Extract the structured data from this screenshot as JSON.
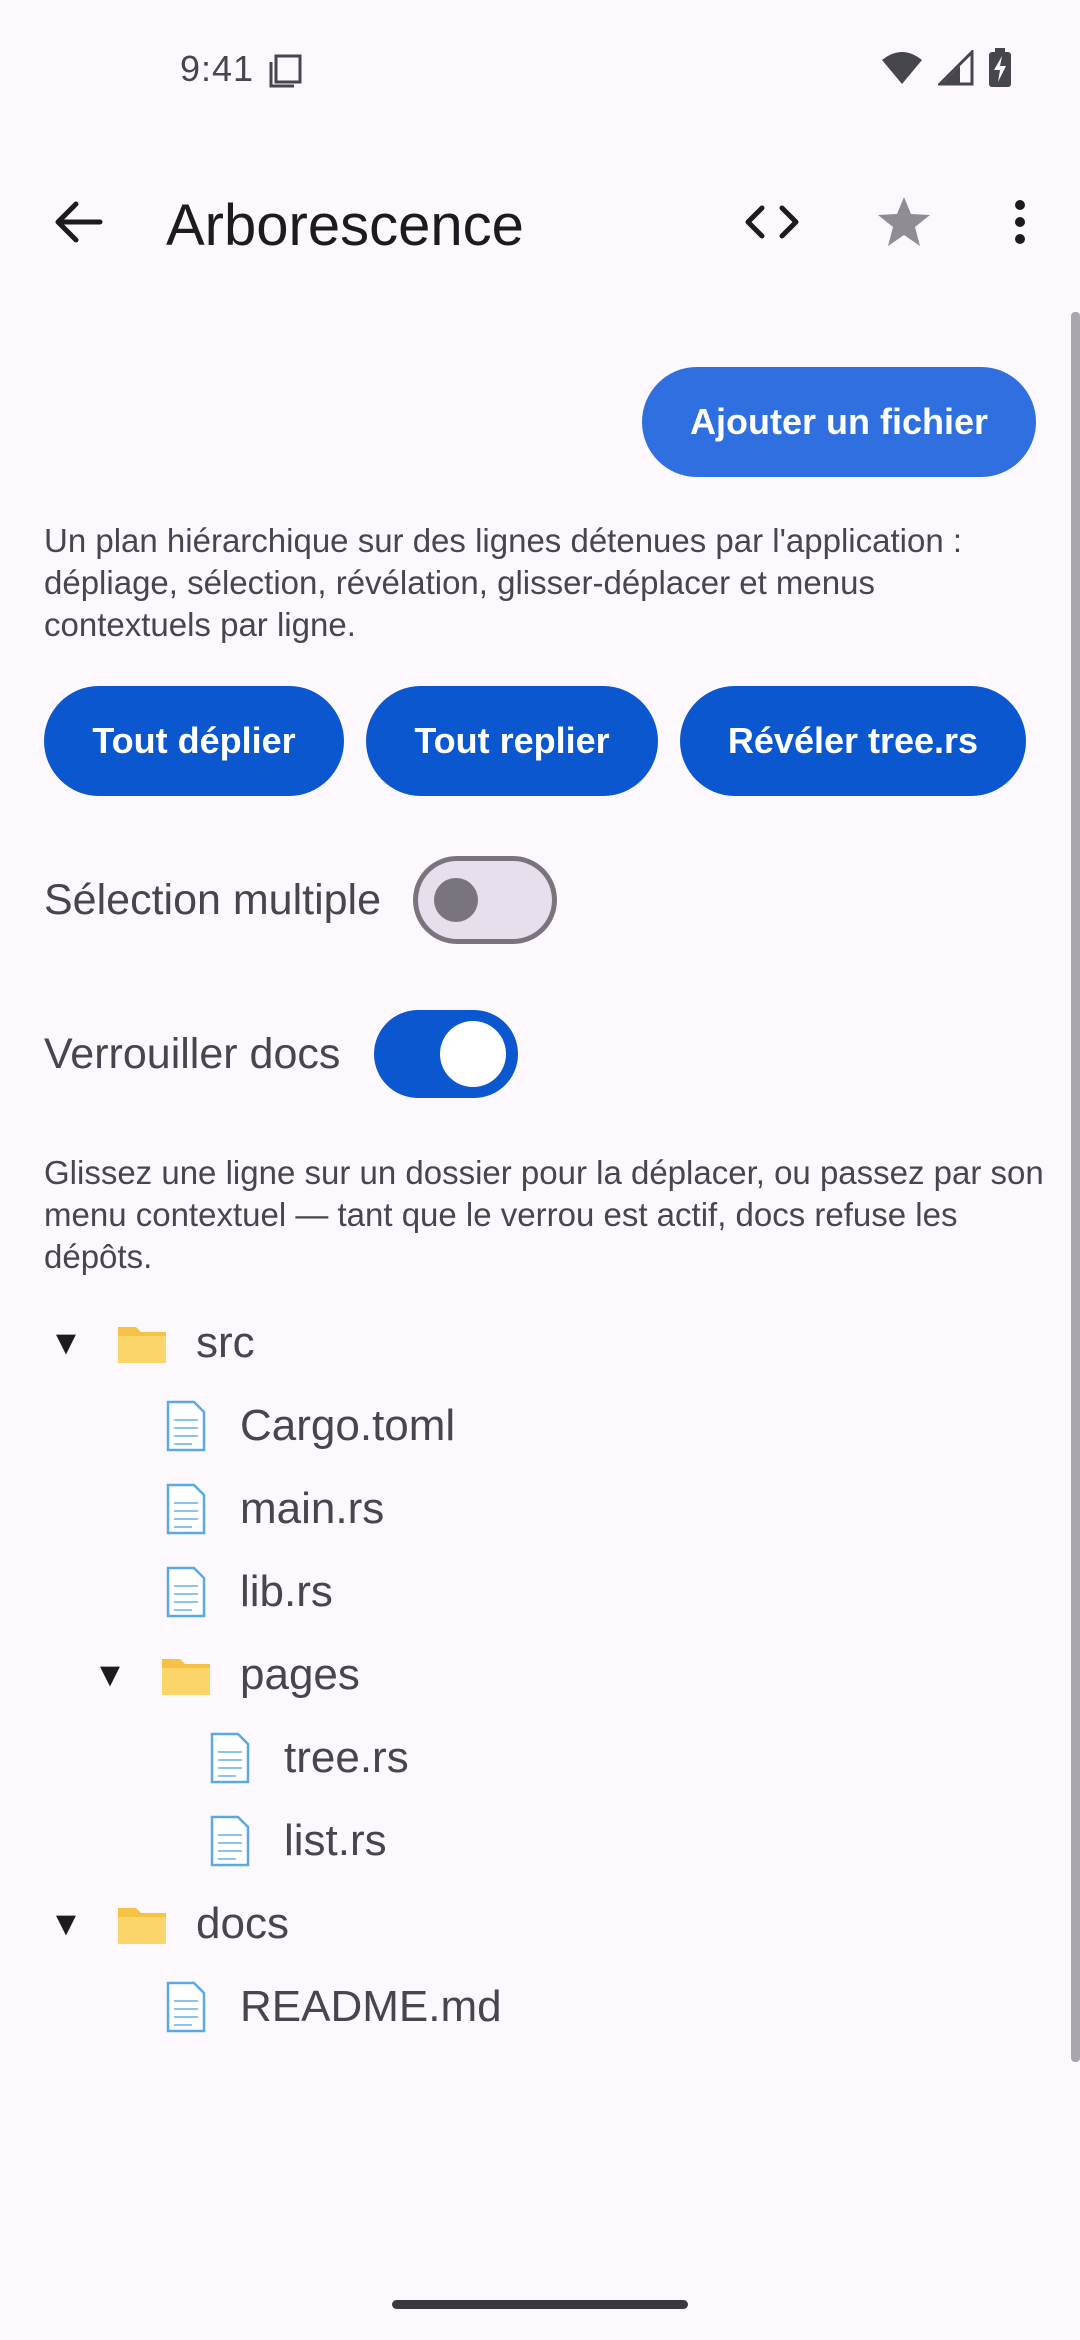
{
  "status_bar": {
    "time": "9:41",
    "icons": [
      "sim-card-icon",
      "wifi-icon",
      "signal-icon",
      "battery-charging-icon"
    ]
  },
  "app_bar": {
    "title": "Arborescence",
    "back_icon": "arrow-back-icon",
    "code_icon": "code-icon",
    "star_icon": "star-icon",
    "more_icon": "more-vert-icon"
  },
  "main": {
    "add_file_label": "Ajouter un fichier",
    "description": "Un plan hiérarchique sur des lignes détenues par l'application : dépliage, sélection, révélation, glisser-déplacer et menus contextuels par ligne.",
    "actions": {
      "expand_all": "Tout déplier",
      "collapse_all": "Tout replier",
      "reveal": "Révéler tree.rs"
    },
    "toggles": {
      "multi_select_label": "Sélection multiple",
      "multi_select_on": false,
      "lock_docs_label": "Verrouiller docs",
      "lock_docs_on": true
    },
    "hint": "Glissez une ligne sur un dossier pour la déplacer, ou passez par son menu contextuel — tant que le verrou est actif, docs refuse les dépôts."
  },
  "tree": {
    "caret_expanded": "▼",
    "nodes": [
      {
        "label": "src",
        "type": "folder",
        "depth": 0,
        "expanded": true
      },
      {
        "label": "Cargo.toml",
        "type": "file",
        "depth": 1
      },
      {
        "label": "main.rs",
        "type": "file",
        "depth": 1
      },
      {
        "label": "lib.rs",
        "type": "file",
        "depth": 1
      },
      {
        "label": "pages",
        "type": "folder",
        "depth": 1,
        "expanded": true
      },
      {
        "label": "tree.rs",
        "type": "file",
        "depth": 2
      },
      {
        "label": "list.rs",
        "type": "file",
        "depth": 2
      },
      {
        "label": "docs",
        "type": "folder",
        "depth": 0,
        "expanded": true
      },
      {
        "label": "README.md",
        "type": "file",
        "depth": 1
      }
    ]
  },
  "colors": {
    "background": "#fdf8fd",
    "primary": "#0b57d0",
    "primary_light": "#2f6fe0",
    "text_secondary": "#46464c",
    "folder": "#f6c244",
    "file": "#5aa9e6"
  }
}
